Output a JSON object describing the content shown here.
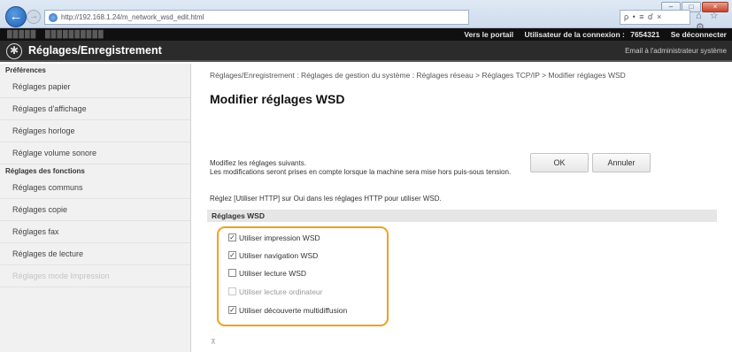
{
  "browser": {
    "url": "http://192.168.1.24/m_network_wsd_edit.html",
    "search_text": "ρ • ≡ ď ×",
    "toolbar_icons": "⌂ ☆ ⚙",
    "win_min": "–",
    "win_max": "□",
    "win_close": "×"
  },
  "header": {
    "portal_link": "Vers le portail",
    "login_label": "Utilisateur de la connexion :",
    "login_user": "7654321",
    "logout_link": "Se déconnecter",
    "title": "Réglages/Enregistrement",
    "admin_email": "Email à l'administrateur système"
  },
  "sidebar": {
    "sections": [
      {
        "title": "Préférences",
        "items": [
          "Réglages papier",
          "Réglages d'affichage",
          "Réglages horloge",
          "Réglage volume sonore"
        ]
      },
      {
        "title": "Réglages des fonctions",
        "items": [
          "Réglages communs",
          "Réglages copie",
          "Réglages fax",
          "Réglages de lecture",
          "Réglages mode Impression"
        ]
      }
    ]
  },
  "main": {
    "breadcrumb": "Réglages/Enregistrement : Réglages de gestion du système : Réglages réseau > Réglages TCP/IP > Modifier réglages WSD",
    "page_title": "Modifier réglages WSD",
    "description_line1": "Modifiez les réglages suivants.",
    "description_line2": "Les modifications seront prises en compte lorsque la machine sera mise hors puis-sous tension.",
    "description_line3": "Réglez [Utiliser HTTP] sur Oui dans les réglages HTTP pour utiliser WSD.",
    "ok_label": "OK",
    "cancel_label": "Annuler",
    "section_title": "Réglages WSD",
    "options": [
      {
        "label": "Utiliser impression WSD",
        "checked": true,
        "disabled": false
      },
      {
        "label": "Utiliser navigation WSD",
        "checked": true,
        "disabled": false
      },
      {
        "label": "Utiliser lecture WSD",
        "checked": false,
        "disabled": false
      },
      {
        "label": "Utiliser lecture ordinateur",
        "checked": false,
        "disabled": true
      },
      {
        "label": "Utiliser découverte multidiffusion",
        "checked": true,
        "disabled": false
      }
    ],
    "highlight_color": "#f0a020"
  }
}
